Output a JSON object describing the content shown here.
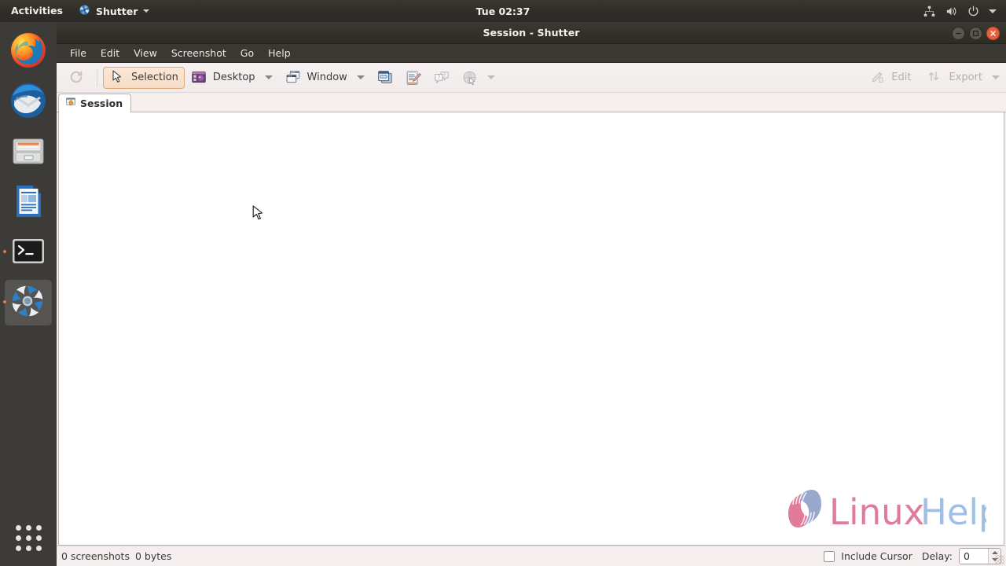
{
  "topbar": {
    "activities": "Activities",
    "app_menu": {
      "name": "Shutter",
      "icon": "shutter-icon"
    },
    "clock": "Tue 02:37",
    "indicators": [
      {
        "name": "network-icon"
      },
      {
        "name": "volume-icon"
      },
      {
        "name": "power-icon"
      },
      {
        "name": "system-menu-caret-icon"
      }
    ]
  },
  "dock": {
    "items": [
      {
        "name": "firefox",
        "label": "Firefox",
        "running": false,
        "active": false
      },
      {
        "name": "thunderbird",
        "label": "Thunderbird",
        "running": false,
        "active": false
      },
      {
        "name": "files",
        "label": "Files",
        "running": false,
        "active": false
      },
      {
        "name": "libreoffice-writer",
        "label": "LibreOffice Writer",
        "running": false,
        "active": false
      },
      {
        "name": "terminal",
        "label": "Terminal",
        "running": true,
        "active": false
      },
      {
        "name": "shutter",
        "label": "Shutter",
        "running": true,
        "active": true
      }
    ],
    "show_applications": "Show Applications"
  },
  "window": {
    "title": "Session - Shutter",
    "buttons": {
      "minimize": "Minimize",
      "maximize": "Maximize",
      "close": "Close"
    }
  },
  "menubar": {
    "items": [
      "File",
      "Edit",
      "View",
      "Screenshot",
      "Go",
      "Help"
    ]
  },
  "toolbar": {
    "refresh": {
      "label": "Redo last screenshot",
      "icon": "refresh-icon",
      "disabled": true
    },
    "selection": {
      "label": "Selection",
      "icon": "selection-cursor-icon",
      "selected": true
    },
    "desktop": {
      "label": "Desktop",
      "icon": "desktop-icon"
    },
    "window": {
      "label": "Window",
      "icon": "window-icon"
    },
    "menu_capture": {
      "label": "Capture menu",
      "icon": "menu-capture-icon"
    },
    "tooltip_capture": {
      "label": "Capture tooltip",
      "icon": "tooltip-capture-icon"
    },
    "webpage_tooltip": {
      "label": "Tooltip",
      "icon": "tooltip-bubbles-icon",
      "disabled": true
    },
    "web": {
      "label": "Web",
      "icon": "globe-icon",
      "disabled": true
    },
    "edit": {
      "label": "Edit",
      "icon": "edit-icon",
      "disabled": true
    },
    "export": {
      "label": "Export",
      "icon": "export-icon",
      "disabled": true
    }
  },
  "tabs": [
    {
      "label": "Session",
      "icon": "session-icon",
      "active": true
    }
  ],
  "canvas": {
    "watermark": {
      "text_left": "Linux",
      "text_right": "Help",
      "color_left": "#e07b9a",
      "color_right": "#9fb7e0"
    }
  },
  "statusbar": {
    "screenshot_count": "0 screenshots",
    "total_size": "0 bytes",
    "include_cursor_label": "Include Cursor",
    "include_cursor_checked": false,
    "delay_label": "Delay:",
    "delay_value": "0"
  },
  "colors": {
    "accent_orange": "#e8734a",
    "titlebar": "#343029",
    "toolbar_bg": "#f3eeed",
    "selected_btn_border": "#dfa877"
  }
}
